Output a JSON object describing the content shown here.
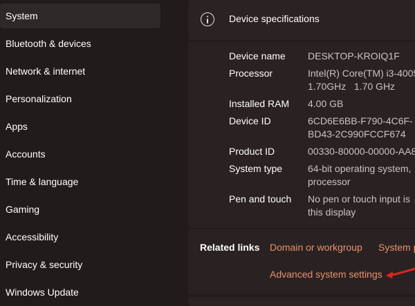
{
  "sidebar": {
    "items": [
      {
        "label": "System"
      },
      {
        "label": "Bluetooth & devices"
      },
      {
        "label": "Network & internet"
      },
      {
        "label": "Personalization"
      },
      {
        "label": "Apps"
      },
      {
        "label": "Accounts"
      },
      {
        "label": "Time & language"
      },
      {
        "label": "Gaming"
      },
      {
        "label": "Accessibility"
      },
      {
        "label": "Privacy & security"
      },
      {
        "label": "Windows Update"
      }
    ]
  },
  "specs": {
    "title": "Device specifications",
    "rows": [
      {
        "label": "Device name",
        "value": "DESKTOP-KROIQ1F"
      },
      {
        "label": "Processor",
        "value": "Intel(R) Core(TM) i3-4005\n1.70GHz   1.70 GHz"
      },
      {
        "label": "Installed RAM",
        "value": "4.00 GB"
      },
      {
        "label": "Device ID",
        "value": "6CD6E6BB-F790-4C6F-\nBD43-2C990FCCF674"
      },
      {
        "label": "Product ID",
        "value": "00330-80000-00000-AA8"
      },
      {
        "label": "System type",
        "value": "64-bit operating system,\nprocessor"
      },
      {
        "label": "Pen and touch",
        "value": "No pen or touch input is\nthis display"
      }
    ]
  },
  "related": {
    "label": "Related links",
    "links": [
      "Domain or workgroup",
      "System p",
      "Advanced system settings"
    ]
  },
  "colors": {
    "link": "#e9906e",
    "annotation_arrow": "#e0241f"
  },
  "icons": {
    "spec_header": "info-icon",
    "annotation": "red-arrow-icon"
  }
}
